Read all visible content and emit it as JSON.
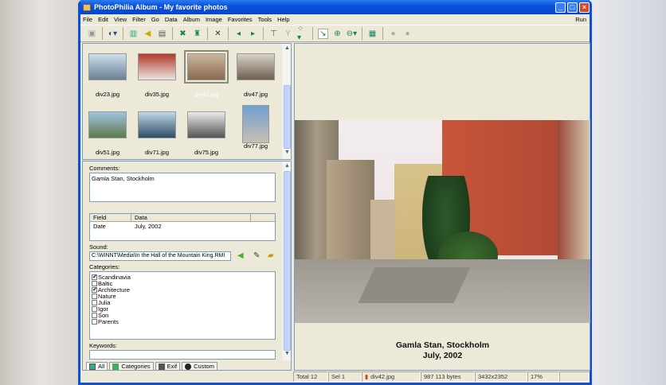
{
  "window": {
    "title": "PhotoPhilia Album - My favorite photos"
  },
  "menu": [
    "File",
    "Edit",
    "View",
    "Filter",
    "Go",
    "Data",
    "Album",
    "Image",
    "Favorites",
    "Tools",
    "Help"
  ],
  "menu_right": "Run",
  "thumbnails": [
    {
      "name": "div23.jpg",
      "selected": false
    },
    {
      "name": "div35.jpg",
      "selected": false
    },
    {
      "name": "div42.jpg",
      "selected": true
    },
    {
      "name": "div47.jpg",
      "selected": false
    },
    {
      "name": "div51.jpg",
      "selected": false
    },
    {
      "name": "div71.jpg",
      "selected": false
    },
    {
      "name": "div75.jpg",
      "selected": false
    },
    {
      "name": "div77.jpg",
      "selected": false
    }
  ],
  "details": {
    "comments_label": "Comments:",
    "comments_value": "Gamla Stan, Stockholm",
    "fields_header": [
      "Field",
      "Data"
    ],
    "fields": [
      {
        "field": "Date",
        "data": "July, 2002"
      }
    ],
    "sound_label": "Sound:",
    "sound_value": "C:\\WINNT\\Media\\In the Hall of the Mountain King.RMI",
    "categories_label": "Categories:",
    "categories": [
      {
        "label": "Scandinavia",
        "checked": true
      },
      {
        "label": "Baltic",
        "checked": false
      },
      {
        "label": "Architecture",
        "checked": true
      },
      {
        "label": "Nature",
        "checked": false
      },
      {
        "label": "Julia",
        "checked": false
      },
      {
        "label": "Igor",
        "checked": false
      },
      {
        "label": "Son",
        "checked": false
      },
      {
        "label": "Parents",
        "checked": false
      }
    ],
    "keywords_label": "Keywords:",
    "keywords_value": ""
  },
  "tabs": [
    "All",
    "Categories",
    "Exif",
    "Custom"
  ],
  "preview": {
    "caption_line1": "Gamla Stan, Stockholm",
    "caption_line2": "July, 2002"
  },
  "status": {
    "total": "Total 12",
    "sel": "Sel 1",
    "file": "div42.jpg",
    "size": "987 113 bytes",
    "dims": "3432x2352",
    "zoom": "17%"
  }
}
